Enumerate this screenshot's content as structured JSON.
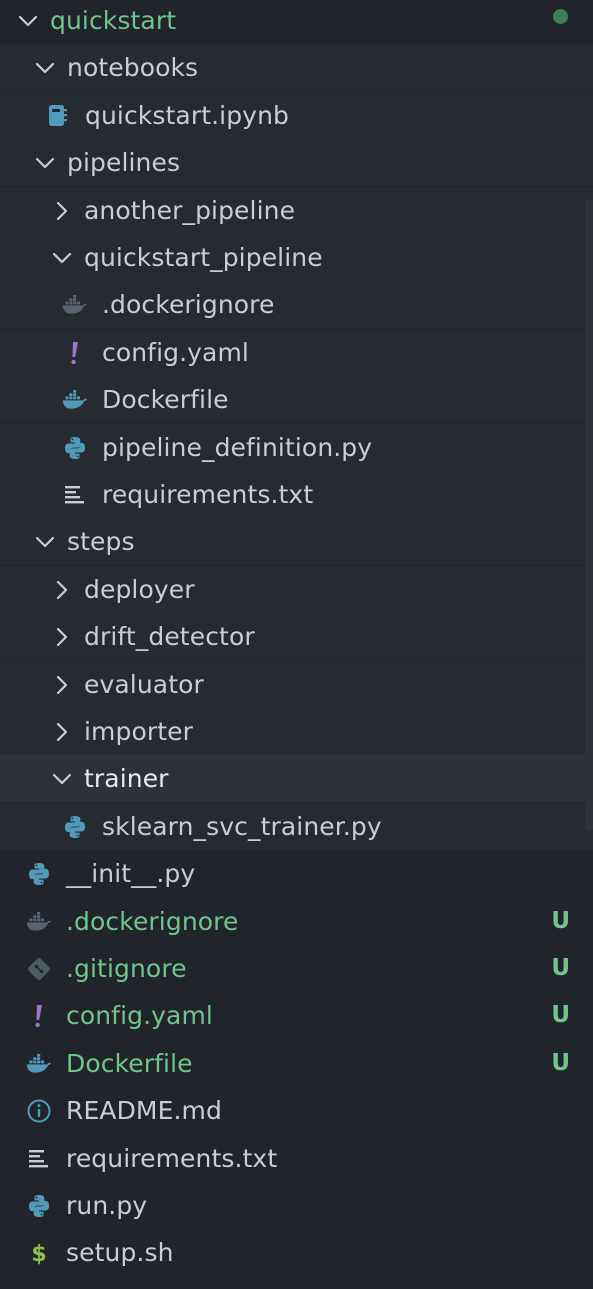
{
  "colors": {
    "background": "#21252b",
    "text": "#c9ced6",
    "git_untracked": "#6fc58d",
    "python_icon": "#519aba",
    "yaml_icon": "#a074c4",
    "docker_icon": "#519aba",
    "shell_icon": "#8dc149",
    "git_icon": "#41535b"
  },
  "tree": [
    {
      "label": "quickstart",
      "depth": 0,
      "type": "folder",
      "expanded": true,
      "icon": "chevron-down-icon",
      "status": "dot",
      "color": "green"
    },
    {
      "label": "notebooks",
      "depth": 1,
      "type": "folder",
      "expanded": true,
      "icon": "chevron-down-icon"
    },
    {
      "label": "quickstart.ipynb",
      "depth": 2,
      "type": "file",
      "icon": "notebook-icon"
    },
    {
      "label": "pipelines",
      "depth": 1,
      "type": "folder",
      "expanded": true,
      "icon": "chevron-down-icon"
    },
    {
      "label": "another_pipeline",
      "depth": 2,
      "type": "folder",
      "expanded": false,
      "icon": "chevron-right-icon"
    },
    {
      "label": "quickstart_pipeline",
      "depth": 2,
      "type": "folder",
      "expanded": true,
      "icon": "chevron-down-icon"
    },
    {
      "label": ".dockerignore",
      "depth": 3,
      "type": "file",
      "icon": "docker-muted-icon"
    },
    {
      "label": "config.yaml",
      "depth": 3,
      "type": "file",
      "icon": "yaml-icon"
    },
    {
      "label": "Dockerfile",
      "depth": 3,
      "type": "file",
      "icon": "docker-icon"
    },
    {
      "label": "pipeline_definition.py",
      "depth": 3,
      "type": "file",
      "icon": "python-icon"
    },
    {
      "label": "requirements.txt",
      "depth": 3,
      "type": "file",
      "icon": "text-file-icon"
    },
    {
      "label": "steps",
      "depth": 1,
      "type": "folder",
      "expanded": true,
      "icon": "chevron-down-icon"
    },
    {
      "label": "deployer",
      "depth": 2,
      "type": "folder",
      "expanded": false,
      "icon": "chevron-right-icon"
    },
    {
      "label": "drift_detector",
      "depth": 2,
      "type": "folder",
      "expanded": false,
      "icon": "chevron-right-icon"
    },
    {
      "label": "evaluator",
      "depth": 2,
      "type": "folder",
      "expanded": false,
      "icon": "chevron-right-icon"
    },
    {
      "label": "importer",
      "depth": 2,
      "type": "folder",
      "expanded": false,
      "icon": "chevron-right-icon"
    },
    {
      "label": "trainer",
      "depth": 2,
      "type": "folder",
      "expanded": true,
      "icon": "chevron-down-icon",
      "selected": true
    },
    {
      "label": "sklearn_svc_trainer.py",
      "depth": 3,
      "type": "file",
      "icon": "python-icon"
    },
    {
      "label": "__init__.py",
      "depth": 1,
      "type": "file",
      "icon": "python-icon"
    },
    {
      "label": ".dockerignore",
      "depth": 1,
      "type": "file",
      "icon": "docker-muted-icon",
      "status": "U",
      "color": "green"
    },
    {
      "label": ".gitignore",
      "depth": 1,
      "type": "file",
      "icon": "git-icon",
      "status": "U",
      "color": "green"
    },
    {
      "label": "config.yaml",
      "depth": 1,
      "type": "file",
      "icon": "yaml-icon",
      "status": "U",
      "color": "green"
    },
    {
      "label": "Dockerfile",
      "depth": 1,
      "type": "file",
      "icon": "docker-icon",
      "status": "U",
      "color": "green"
    },
    {
      "label": "README.md",
      "depth": 1,
      "type": "file",
      "icon": "info-icon"
    },
    {
      "label": "requirements.txt",
      "depth": 1,
      "type": "file",
      "icon": "text-file-icon"
    },
    {
      "label": "run.py",
      "depth": 1,
      "type": "file",
      "icon": "python-icon"
    },
    {
      "label": "setup.sh",
      "depth": 1,
      "type": "file",
      "icon": "shell-icon"
    }
  ]
}
